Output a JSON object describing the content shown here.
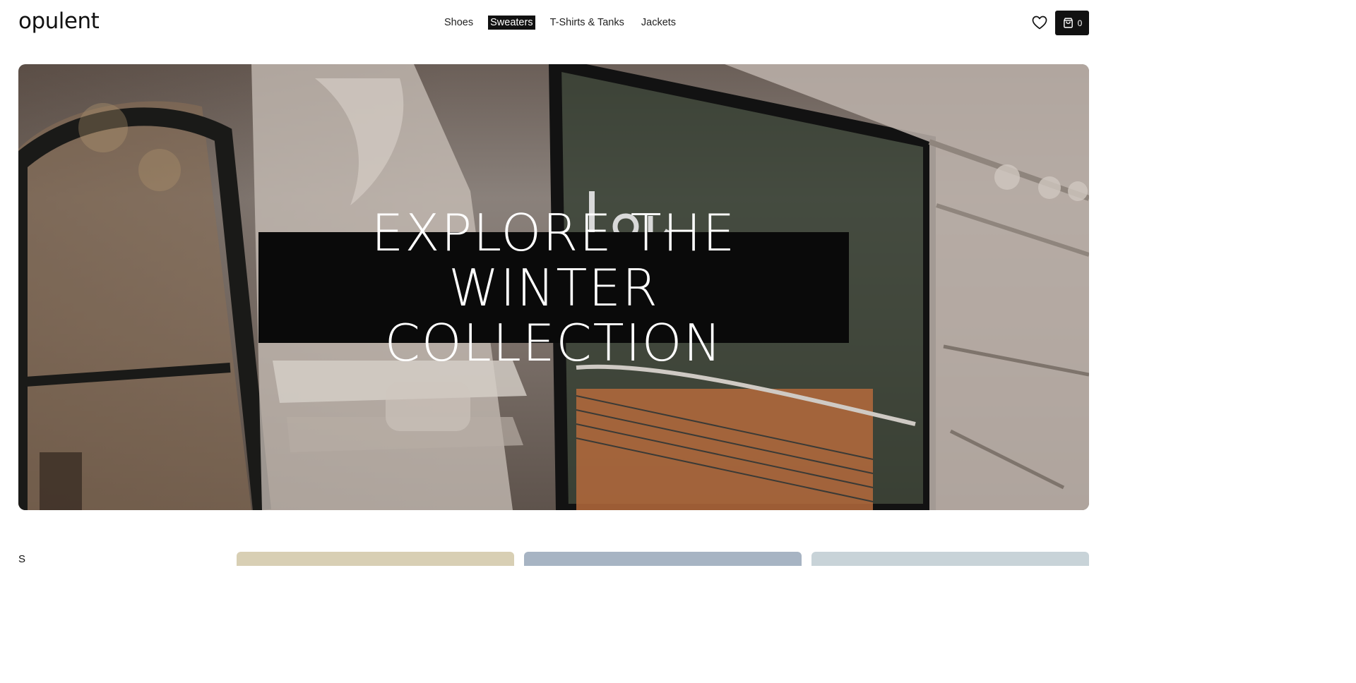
{
  "brand": {
    "logo_text": "opulent"
  },
  "nav": {
    "items": [
      {
        "label": "Shoes",
        "active": false
      },
      {
        "label": "Sweaters",
        "active": true
      },
      {
        "label": "T-Shirts & Tanks",
        "active": false
      },
      {
        "label": "Jackets",
        "active": false
      }
    ]
  },
  "header_actions": {
    "wishlist_icon": "heart-icon",
    "cart_icon": "shopping-bag-icon",
    "cart_count": "0"
  },
  "hero": {
    "title": "EXPLORE THE WINTER COLLECTION",
    "banner_color": "#0a0a0a"
  },
  "section": {
    "label": "S"
  },
  "colors": {
    "accent": "#111111",
    "background": "#ffffff"
  }
}
